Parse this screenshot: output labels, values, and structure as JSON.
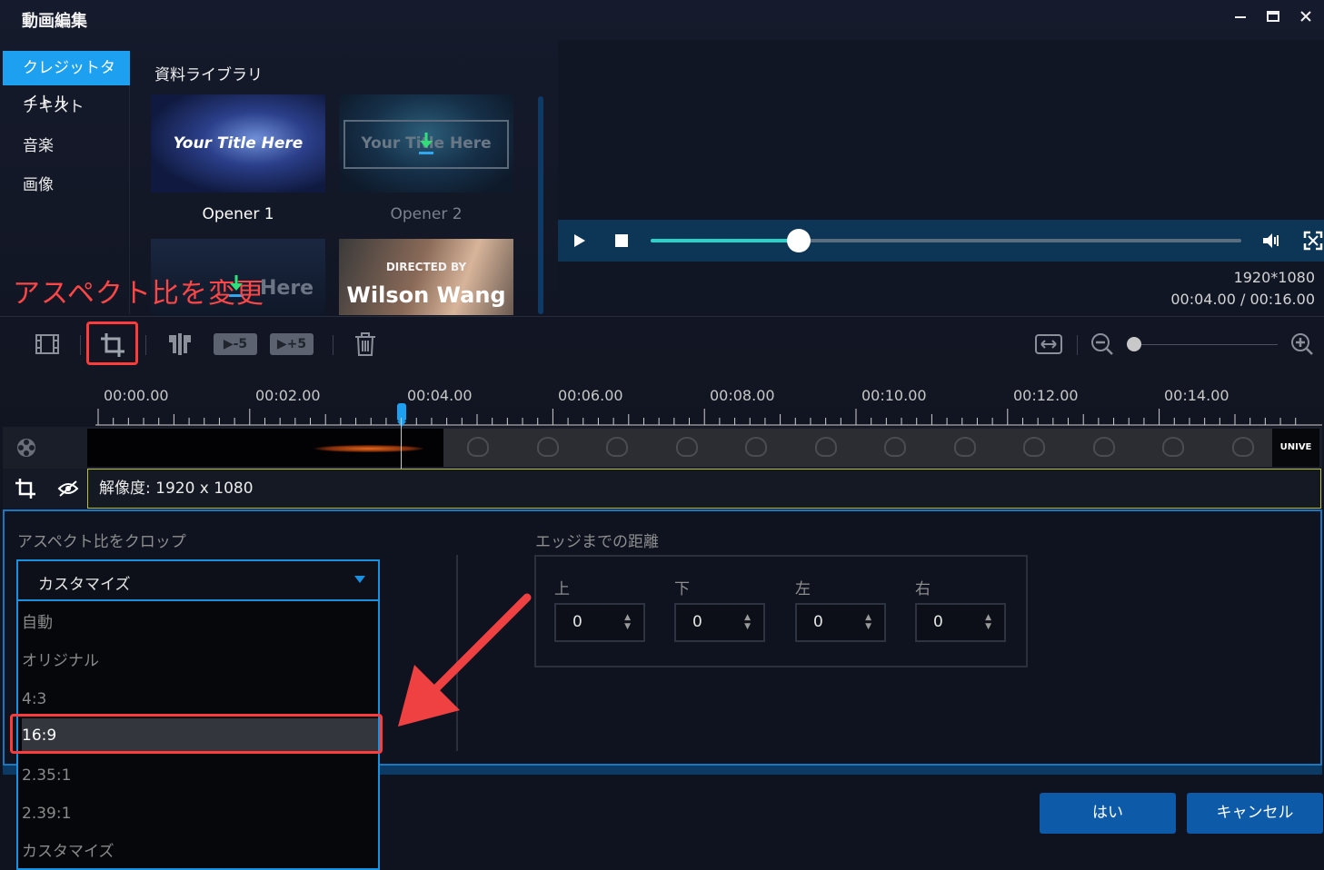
{
  "window": {
    "title": "動画編集",
    "minimize_icon": "minimize-icon",
    "maximize_icon": "maximize-icon",
    "close_icon": "close-icon"
  },
  "left_nav": {
    "items": [
      {
        "label": "クレジットタイトル",
        "active": true
      },
      {
        "label": "テキスト",
        "active": false
      },
      {
        "label": "音楽",
        "active": false
      },
      {
        "label": "画像",
        "active": false
      }
    ]
  },
  "library": {
    "title": "資料ライブラリ",
    "cards": [
      {
        "label": "Opener 1",
        "thumb_text": "Your Title Here",
        "download": false
      },
      {
        "label": "Opener 2",
        "thumb_text": "Your Title Here",
        "download": true
      },
      {
        "label": "",
        "thumb_text": "Here",
        "download": true
      },
      {
        "label": "",
        "thumb_text_1": "DIRECTED BY",
        "thumb_text_2": "Wilson Wang",
        "download": false
      }
    ]
  },
  "annotation": {
    "text": "アスペクト比を変更"
  },
  "player": {
    "play_icon": "play-icon",
    "stop_icon": "stop-icon",
    "progress": 0.25,
    "volume_icon": "volume-icon",
    "fullscreen_icon": "fullscreen-icon",
    "resolution": "1920*1080",
    "time": "00:04.00 / 00:16.00"
  },
  "toolbar": {
    "tools": [
      "film-icon",
      "crop-icon",
      "split-icon",
      "back-5-icon",
      "forward-5-icon",
      "delete-icon",
      "fit-width-icon",
      "zoom-out-icon",
      "zoom-in-icon"
    ],
    "back_label": "-5",
    "forward_label": "+5",
    "zoom_level": 0.0
  },
  "ruler": {
    "labels": [
      "00:00.00",
      "00:02.00",
      "00:04.00",
      "00:06.00",
      "00:08.00",
      "00:10.00",
      "00:12.00",
      "00:14.00"
    ],
    "playhead_time": "00:04.00"
  },
  "tracks": {
    "video_icon": "film-reel-icon",
    "end_clip_text": "UNIVE",
    "crop_icon": "crop-icon",
    "visibility_icon": "eye-off-icon",
    "crop_info": "解像度: 1920 x 1080"
  },
  "crop_panel": {
    "aspect_label": "アスペクト比をクロップ",
    "selected_value": "カスタマイズ",
    "options": [
      "自動",
      "オリジナル",
      "4:3",
      "16:9",
      "2.35:1",
      "2.39:1",
      "カスタマイズ"
    ],
    "highlighted_option": "16:9",
    "edge_label": "エッジまでの距離",
    "edges": [
      {
        "label": "上",
        "value": "0"
      },
      {
        "label": "下",
        "value": "0"
      },
      {
        "label": "左",
        "value": "0"
      },
      {
        "label": "右",
        "value": "0"
      }
    ]
  },
  "buttons": {
    "ok": "はい",
    "cancel": "キャンセル"
  },
  "colors": {
    "accent": "#1ea0f0",
    "annotation_red": "#ff3b3b",
    "button_blue": "#0d5aa8"
  }
}
